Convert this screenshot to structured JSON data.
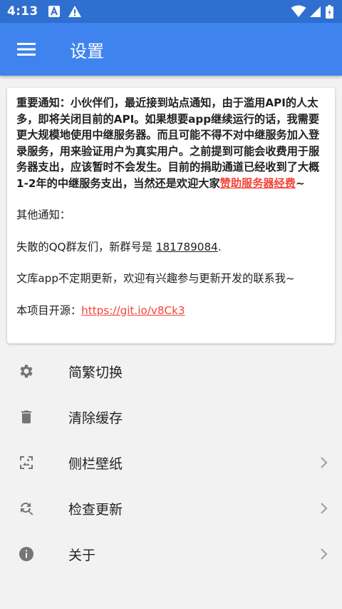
{
  "status_bar": {
    "time": "4:13",
    "icons": [
      "notification-a-icon",
      "warning-icon",
      "wifi-icon",
      "signal-icon",
      "battery-icon"
    ]
  },
  "app_bar": {
    "menu_icon": "hamburger-menu-icon",
    "title": "设置"
  },
  "notice_card": {
    "notice_text": "重要通知：小伙伴们，最近接到站点通知，由于滥用API的人太多，即将关闭目前的API。如果想要app继续运行的话，我需要更大规模地使用中继服务器。而且可能不得不对中继服务加入登录服务，用来验证用户为真实用户。之前提到可能会收费用于服务器支出，应该暂时不会发生。目前的捐助通道已经收到了大概1-2年的中继服务支出，当然还是欢迎大家",
    "sponsor_link": "赞助服务器经费",
    "notice_suffix": "~",
    "other_notice": "其他通知：",
    "qq_prefix": "失散的QQ群友们，新群号是 ",
    "qq_number": "181789084",
    "qq_suffix": ".",
    "update_text": "文库app不定期更新，欢迎有兴趣参与更新开发的联系我~",
    "source_prefix": "本项目开源：",
    "source_link": "https://git.io/v8Ck3"
  },
  "settings_list": [
    {
      "icon": "gear-icon",
      "label": "简繁切换",
      "chevron": false
    },
    {
      "icon": "trash-icon",
      "label": "清除缓存",
      "chevron": false
    },
    {
      "icon": "wallpaper-icon",
      "label": "侧栏壁纸",
      "chevron": true
    },
    {
      "icon": "refresh-search-icon",
      "label": "检查更新",
      "chevron": true
    },
    {
      "icon": "info-icon",
      "label": "关于",
      "chevron": true
    }
  ],
  "colors": {
    "status_bar": "#2f6fd0",
    "app_bar": "#3f83ee",
    "link": "#f44336",
    "background": "#f2f2f2"
  }
}
